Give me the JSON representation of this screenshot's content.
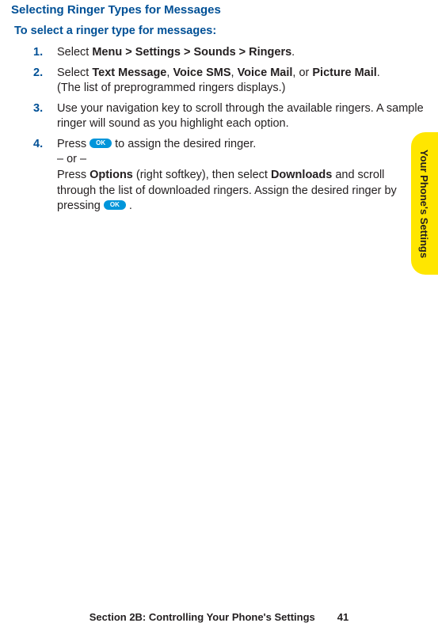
{
  "heading": "Selecting Ringer Types for Messages",
  "intro": "To select a ringer type for messages:",
  "steps": {
    "1": {
      "num": "1.",
      "prefix": "Select ",
      "menu": "Menu",
      "sep1": " > ",
      "settings": "Settings",
      "sep2": " > ",
      "sounds": "Sounds",
      "sep3": " > ",
      "ringers": "Ringers",
      "period": "."
    },
    "2": {
      "num": "2.",
      "prefix": "Select ",
      "text_message": "Text Message",
      "c1": ", ",
      "voice_sms": "Voice SMS",
      "c2": ", ",
      "voice_mail": "Voice Mail",
      "c3": ", or ",
      "picture_mail": "Picture Mail",
      "period": ".",
      "line2": "(The list of preprogrammed ringers displays.)"
    },
    "3": {
      "num": "3.",
      "text": "Use your navigation key to scroll through the available ringers. A sample ringer will sound as you highlight each option."
    },
    "4": {
      "num": "4.",
      "p1_a": "Press ",
      "ok1": "OK",
      "p1_b": " to assign the desired ringer.",
      "or_line": "– or –",
      "p2_a": "Press ",
      "options": "Options",
      "p2_b": " (right softkey), then select ",
      "downloads": "Downloads",
      "p2_c": " and scroll through the list of downloaded ringers. Assign the desired ringer by pressing ",
      "ok2": "OK",
      "p2_d": " ."
    }
  },
  "side_tab": "Your Phone's Settings",
  "footer": {
    "section": "Section 2B: Controlling Your Phone's Settings",
    "page": "41"
  }
}
